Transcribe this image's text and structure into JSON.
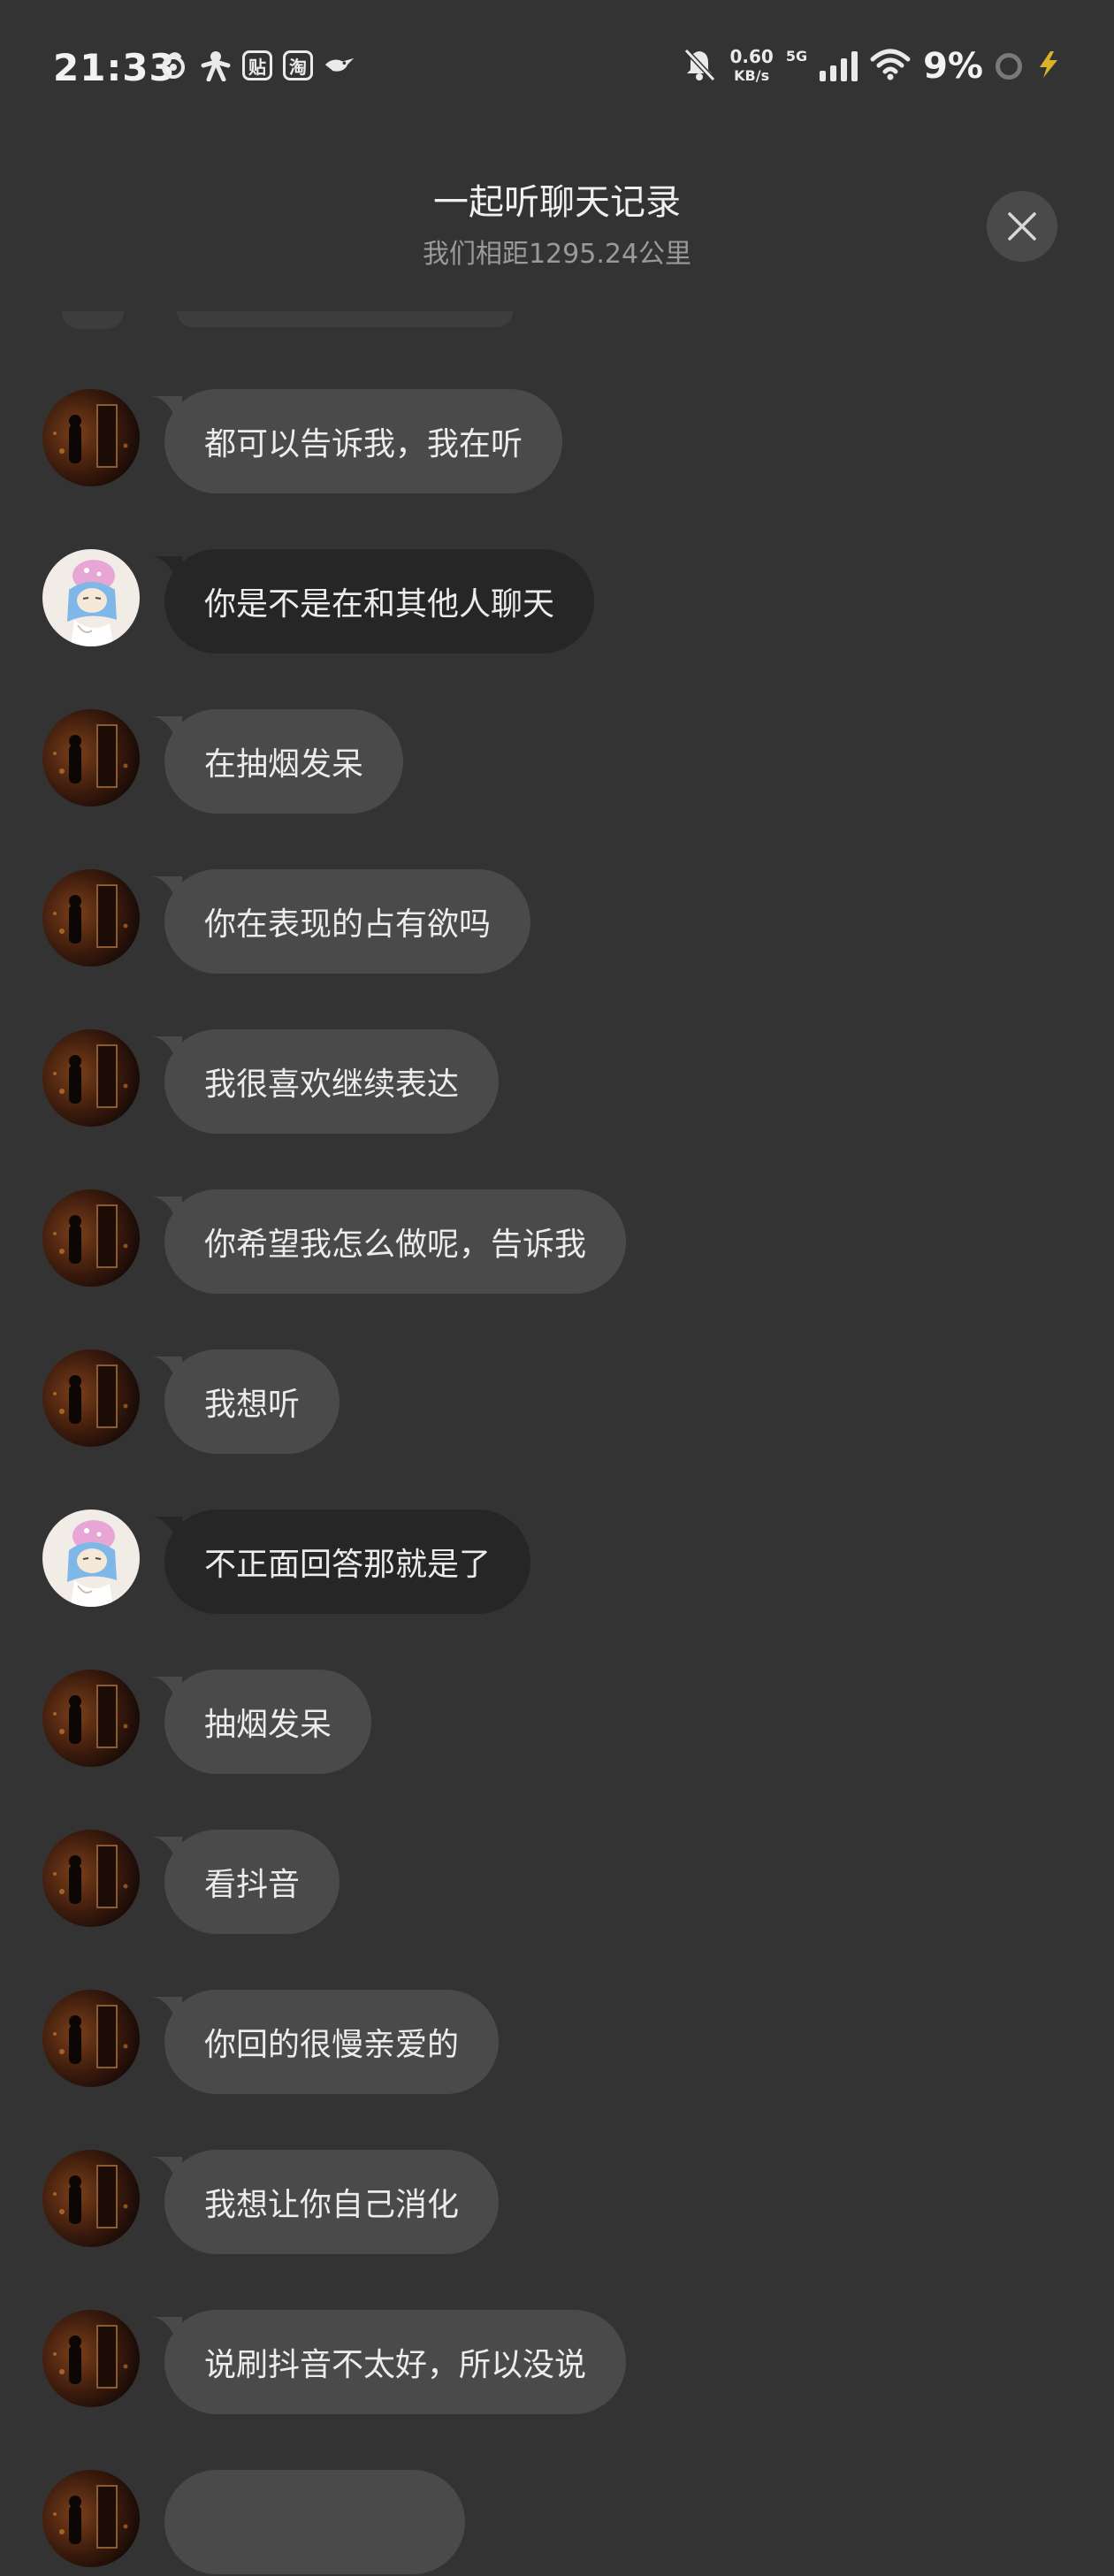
{
  "status_bar": {
    "time": "21:33",
    "left_icons": [
      "netease-music-icon",
      "person-app-icon",
      "tieba-icon",
      "taobao-icon",
      "bird-app-icon"
    ],
    "tieba_label": "贴",
    "taobao_label": "淘",
    "net_speed": "0.60",
    "net_unit": "KB/s",
    "network": "5G",
    "battery": "9%"
  },
  "header": {
    "title": "一起听聊天记录",
    "subtitle": "我们相距1295.24公里"
  },
  "messages": [
    {
      "sender": "other",
      "text": "都可以告诉我，我在听"
    },
    {
      "sender": "me",
      "text": "你是不是在和其他人聊天"
    },
    {
      "sender": "other",
      "text": "在抽烟发呆"
    },
    {
      "sender": "other",
      "text": "你在表现的占有欲吗"
    },
    {
      "sender": "other",
      "text": "我很喜欢继续表达"
    },
    {
      "sender": "other",
      "text": "你希望我怎么做呢，告诉我"
    },
    {
      "sender": "other",
      "text": "我想听"
    },
    {
      "sender": "me",
      "text": "不正面回答那就是了"
    },
    {
      "sender": "other",
      "text": "抽烟发呆"
    },
    {
      "sender": "other",
      "text": "看抖音"
    },
    {
      "sender": "other",
      "text": "你回的很慢亲爱的"
    },
    {
      "sender": "other",
      "text": "我想让你自己消化"
    },
    {
      "sender": "other",
      "text": "说刷抖音不太好，所以没说"
    }
  ],
  "colors": {
    "background": "#333333",
    "other_bubble": "#4a4a4a",
    "my_bubble": "#262626",
    "text": "#ececec",
    "subtitle": "#9a9a9a"
  }
}
